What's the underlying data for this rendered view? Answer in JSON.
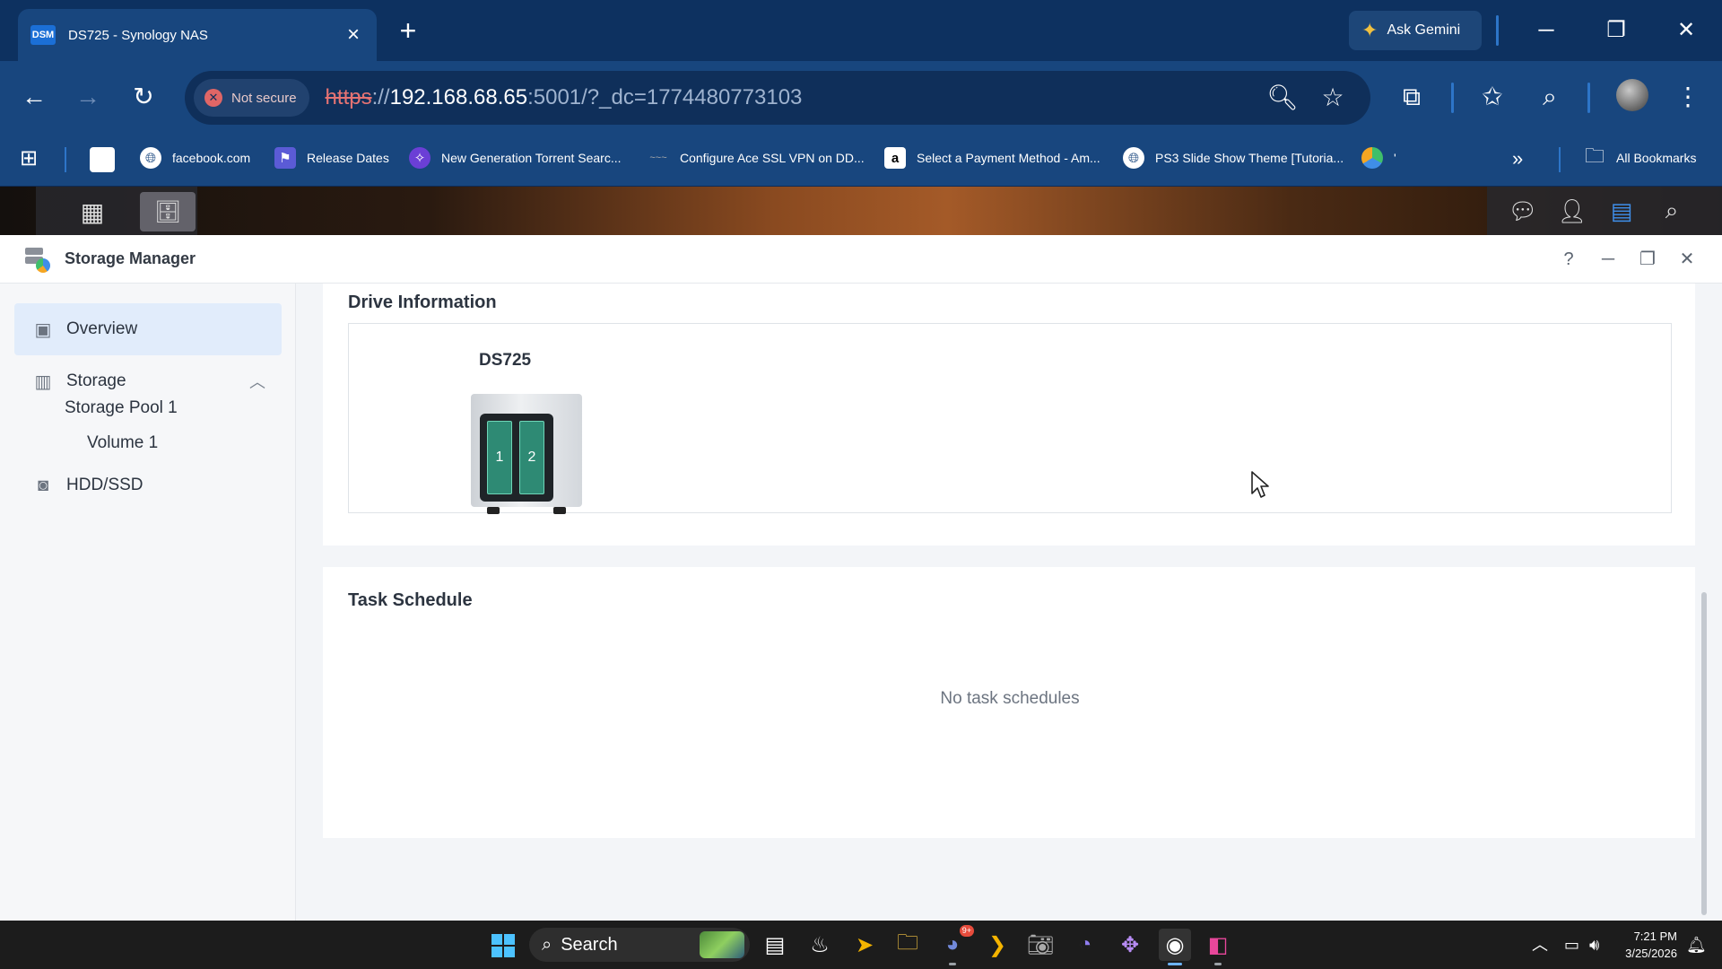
{
  "browser": {
    "tab": {
      "favicon_text": "DSM",
      "title": "DS725 - Synology NAS"
    },
    "gemini_label": "Ask Gemini",
    "security_label": "Not secure",
    "url": {
      "protocol": "https",
      "separator": "://",
      "host": "192.168.68.65",
      "rest": ":5001/?_dc=1774480773103"
    },
    "bookmarks": [
      {
        "label": "facebook.com",
        "icon": "globe-icon"
      },
      {
        "label": "Release Dates",
        "icon": "flag-icon"
      },
      {
        "label": "New Generation Torrent Searc...",
        "icon": "torrent-icon"
      },
      {
        "label": "Configure Ace SSL VPN on DD...",
        "icon": "vpn-icon"
      },
      {
        "label": "Select a Payment Method - Am...",
        "icon": "amazon-icon"
      },
      {
        "label": "PS3 Slide Show Theme [Tutoria...",
        "icon": "globe-icon"
      },
      {
        "label": "'",
        "icon": "colorful-icon"
      }
    ],
    "all_bookmarks_label": "All Bookmarks"
  },
  "dsm": {
    "window_title": "Storage Manager",
    "sidebar": {
      "items": [
        {
          "label": "Overview",
          "icon": "overview-icon"
        },
        {
          "label": "Storage",
          "icon": "storage-icon"
        },
        {
          "label": "HDD/SSD",
          "icon": "hdd-icon"
        }
      ],
      "storage_pool": "Storage Pool 1",
      "volume": "Volume 1"
    },
    "drive_information": {
      "heading": "Drive Information",
      "model": "DS725",
      "bays": [
        "1",
        "2"
      ]
    },
    "task_schedule": {
      "heading": "Task Schedule",
      "empty_text": "No task schedules"
    }
  },
  "taskbar": {
    "search_label": "Search",
    "discord_badge": "9+",
    "time": "7:21 PM",
    "date": "3/25/2026"
  },
  "colors": {
    "browser_frame": "#0d3160",
    "browser_toolbar": "#18467e",
    "sidebar_active": "#e1ecfb",
    "nas_bay": "#2e8a74"
  }
}
